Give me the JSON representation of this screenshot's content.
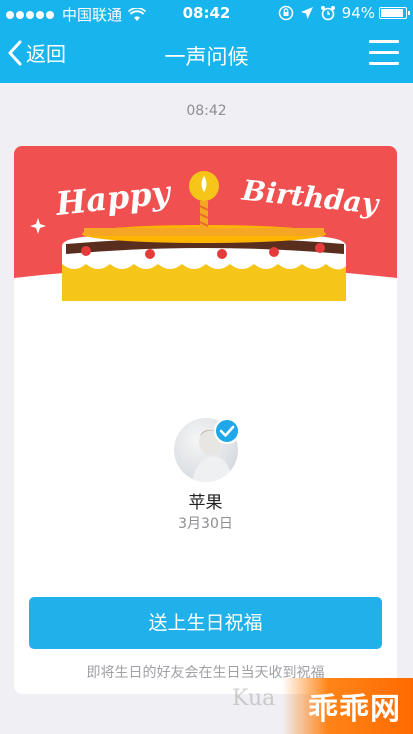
{
  "status_bar": {
    "carrier": "中国联通",
    "time": "08:42",
    "battery": "94%",
    "battery_level": 0.94
  },
  "nav": {
    "back_label": "返回",
    "title": "一声问候"
  },
  "chat": {
    "timestamp": "08:42"
  },
  "card": {
    "banner_left": "Happy",
    "banner_right": "Birthday",
    "name": "苹果",
    "date": "3月30日",
    "button_label": "送上生日祝福",
    "hint": "即将生日的好友会在生日当天收到祝福"
  },
  "watermark": {
    "text": "Kua",
    "logo": "乖乖网"
  },
  "colors": {
    "header": "#18b4ed",
    "banner": "#f0504f",
    "button": "#21b1ea",
    "cake_yellow": "#f5c518"
  },
  "icons": [
    "wifi-icon",
    "lock-rotation-icon",
    "location-icon",
    "alarm-icon",
    "battery-icon",
    "back-chevron-icon",
    "menu-icon",
    "verified-icon"
  ]
}
